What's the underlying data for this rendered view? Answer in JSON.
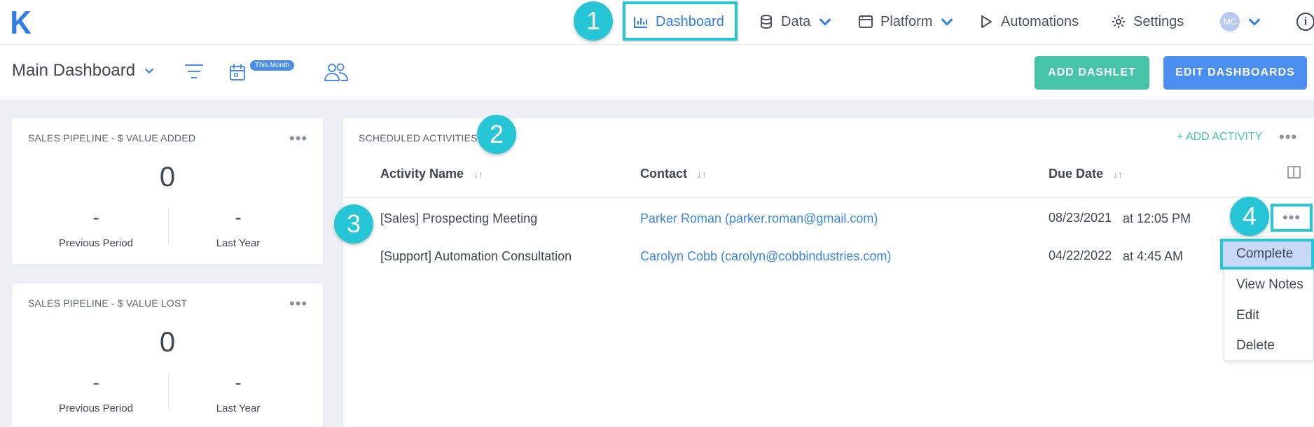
{
  "brand": {
    "logo": "K",
    "color": "#2f7ee8"
  },
  "nav": {
    "dashboard": "Dashboard",
    "data": "Data",
    "platform": "Platform",
    "automations": "Automations",
    "settings": "Settings",
    "avatar": "MC",
    "info": "i"
  },
  "badges": {
    "b1": "1",
    "b2": "2",
    "b3": "3",
    "b4": "4"
  },
  "subheader": {
    "title": "Main Dashboard",
    "date_badge": "This Month",
    "add_dashlet": "ADD DASHLET",
    "edit_dashboards": "EDIT DASHBOARDS"
  },
  "cards": [
    {
      "title": "SALES PIPELINE - $ VALUE ADDED",
      "value": "0",
      "left_value": "-",
      "left_label": "Previous Period",
      "right_value": "-",
      "right_label": "Last Year"
    },
    {
      "title": "SALES PIPELINE - $ VALUE LOST",
      "value": "0",
      "left_value": "-",
      "left_label": "Previous Period",
      "right_value": "-",
      "right_label": "Last Year"
    }
  ],
  "activities": {
    "title": "SCHEDULED ACTIVITIES",
    "add_label": "+ ADD ACTIVITY",
    "columns": [
      "Activity Name",
      "Contact",
      "Due Date"
    ],
    "rows": [
      {
        "name": "[Sales] Prospecting Meeting",
        "contact": "Parker Roman (parker.roman@gmail.com)",
        "date": "08/23/2021",
        "time": "at 12:05 PM"
      },
      {
        "name": "[Support] Automation Consultation",
        "contact": "Carolyn Cobb (carolyn@cobbindustries.com)",
        "date": "04/22/2022",
        "time": "at 4:45 AM"
      }
    ],
    "menu": [
      "Complete",
      "View Notes",
      "Edit",
      "Delete"
    ]
  },
  "colors": {
    "accent": "#26c6d6",
    "primary": "#4c8ef0",
    "success": "#45c4a8",
    "link": "#3a86e8"
  }
}
